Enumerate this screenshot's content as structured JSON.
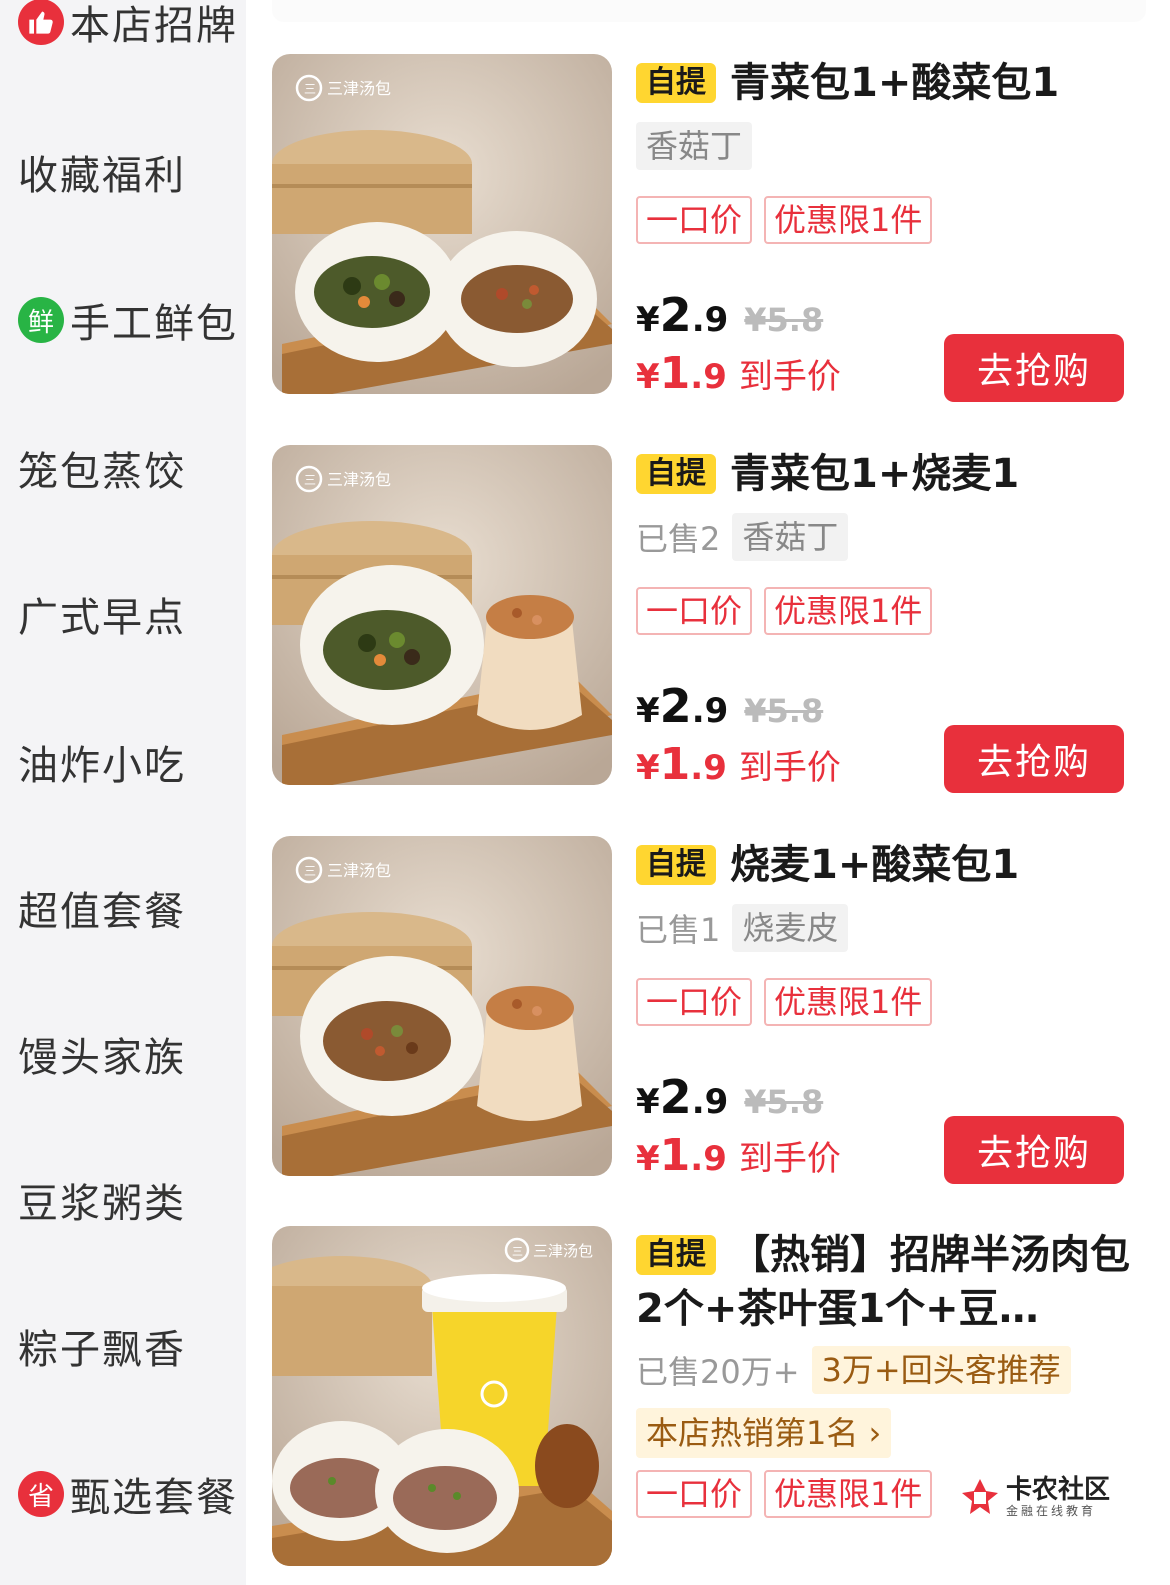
{
  "sidebar": {
    "items": [
      {
        "label": "本店招牌",
        "badge_icon": "thumbs-up-icon",
        "badge_color": "#e8303c"
      },
      {
        "label": "收藏福利"
      },
      {
        "label": "手工鲜包",
        "badge_text": "鲜",
        "badge_color": "#28b445"
      },
      {
        "label": "笼包蒸饺"
      },
      {
        "label": "广式早点"
      },
      {
        "label": "油炸小吃"
      },
      {
        "label": "超值套餐"
      },
      {
        "label": "馒头家族"
      },
      {
        "label": "豆浆粥类"
      },
      {
        "label": "粽子飘香"
      },
      {
        "label": "甄选套餐",
        "badge_text": "省",
        "badge_color": "#e8303c"
      }
    ]
  },
  "products": [
    {
      "tag": "自提",
      "title": "青菜包1+酸菜包1",
      "sold": "",
      "chips": [
        "香菇丁"
      ],
      "promos": [
        "一口价",
        "优惠限1件"
      ],
      "price_currency": "¥",
      "price_int": "2",
      "price_dec": ".9",
      "orig_price": "¥5.8",
      "net_currency": "¥",
      "net_int": "1",
      "net_dec": ".9",
      "net_label": "到手价",
      "buy_label": "去抢购",
      "brand_logo": "三津汤包"
    },
    {
      "tag": "自提",
      "title": "青菜包1+烧麦1",
      "sold": "已售2",
      "chips": [
        "香菇丁"
      ],
      "promos": [
        "一口价",
        "优惠限1件"
      ],
      "price_currency": "¥",
      "price_int": "2",
      "price_dec": ".9",
      "orig_price": "¥5.8",
      "net_currency": "¥",
      "net_int": "1",
      "net_dec": ".9",
      "net_label": "到手价",
      "buy_label": "去抢购",
      "brand_logo": "三津汤包"
    },
    {
      "tag": "自提",
      "title": "烧麦1+酸菜包1",
      "sold": "已售1",
      "chips": [
        "烧麦皮"
      ],
      "promos": [
        "一口价",
        "优惠限1件"
      ],
      "price_currency": "¥",
      "price_int": "2",
      "price_dec": ".9",
      "orig_price": "¥5.8",
      "net_currency": "¥",
      "net_int": "1",
      "net_dec": ".9",
      "net_label": "到手价",
      "buy_label": "去抢购",
      "brand_logo": "三津汤包"
    },
    {
      "tag": "自提",
      "title": "【热销】招牌半汤肉包2个+茶叶蛋1个+豆…",
      "sold": "已售20万+",
      "warm_chip": "3万+回头客推荐",
      "rank": "本店热销第1名 ›",
      "promos": [
        "一口价",
        "优惠限1件"
      ],
      "brand_logo": "三津汤包"
    }
  ],
  "watermark": {
    "name": "卡农社区",
    "sub": "金融在线教育"
  },
  "colors": {
    "accent_red": "#e8303c",
    "tag_yellow": "#ffd630",
    "sidebar_bg": "#f4f4f6",
    "fresh_green": "#28b445"
  }
}
